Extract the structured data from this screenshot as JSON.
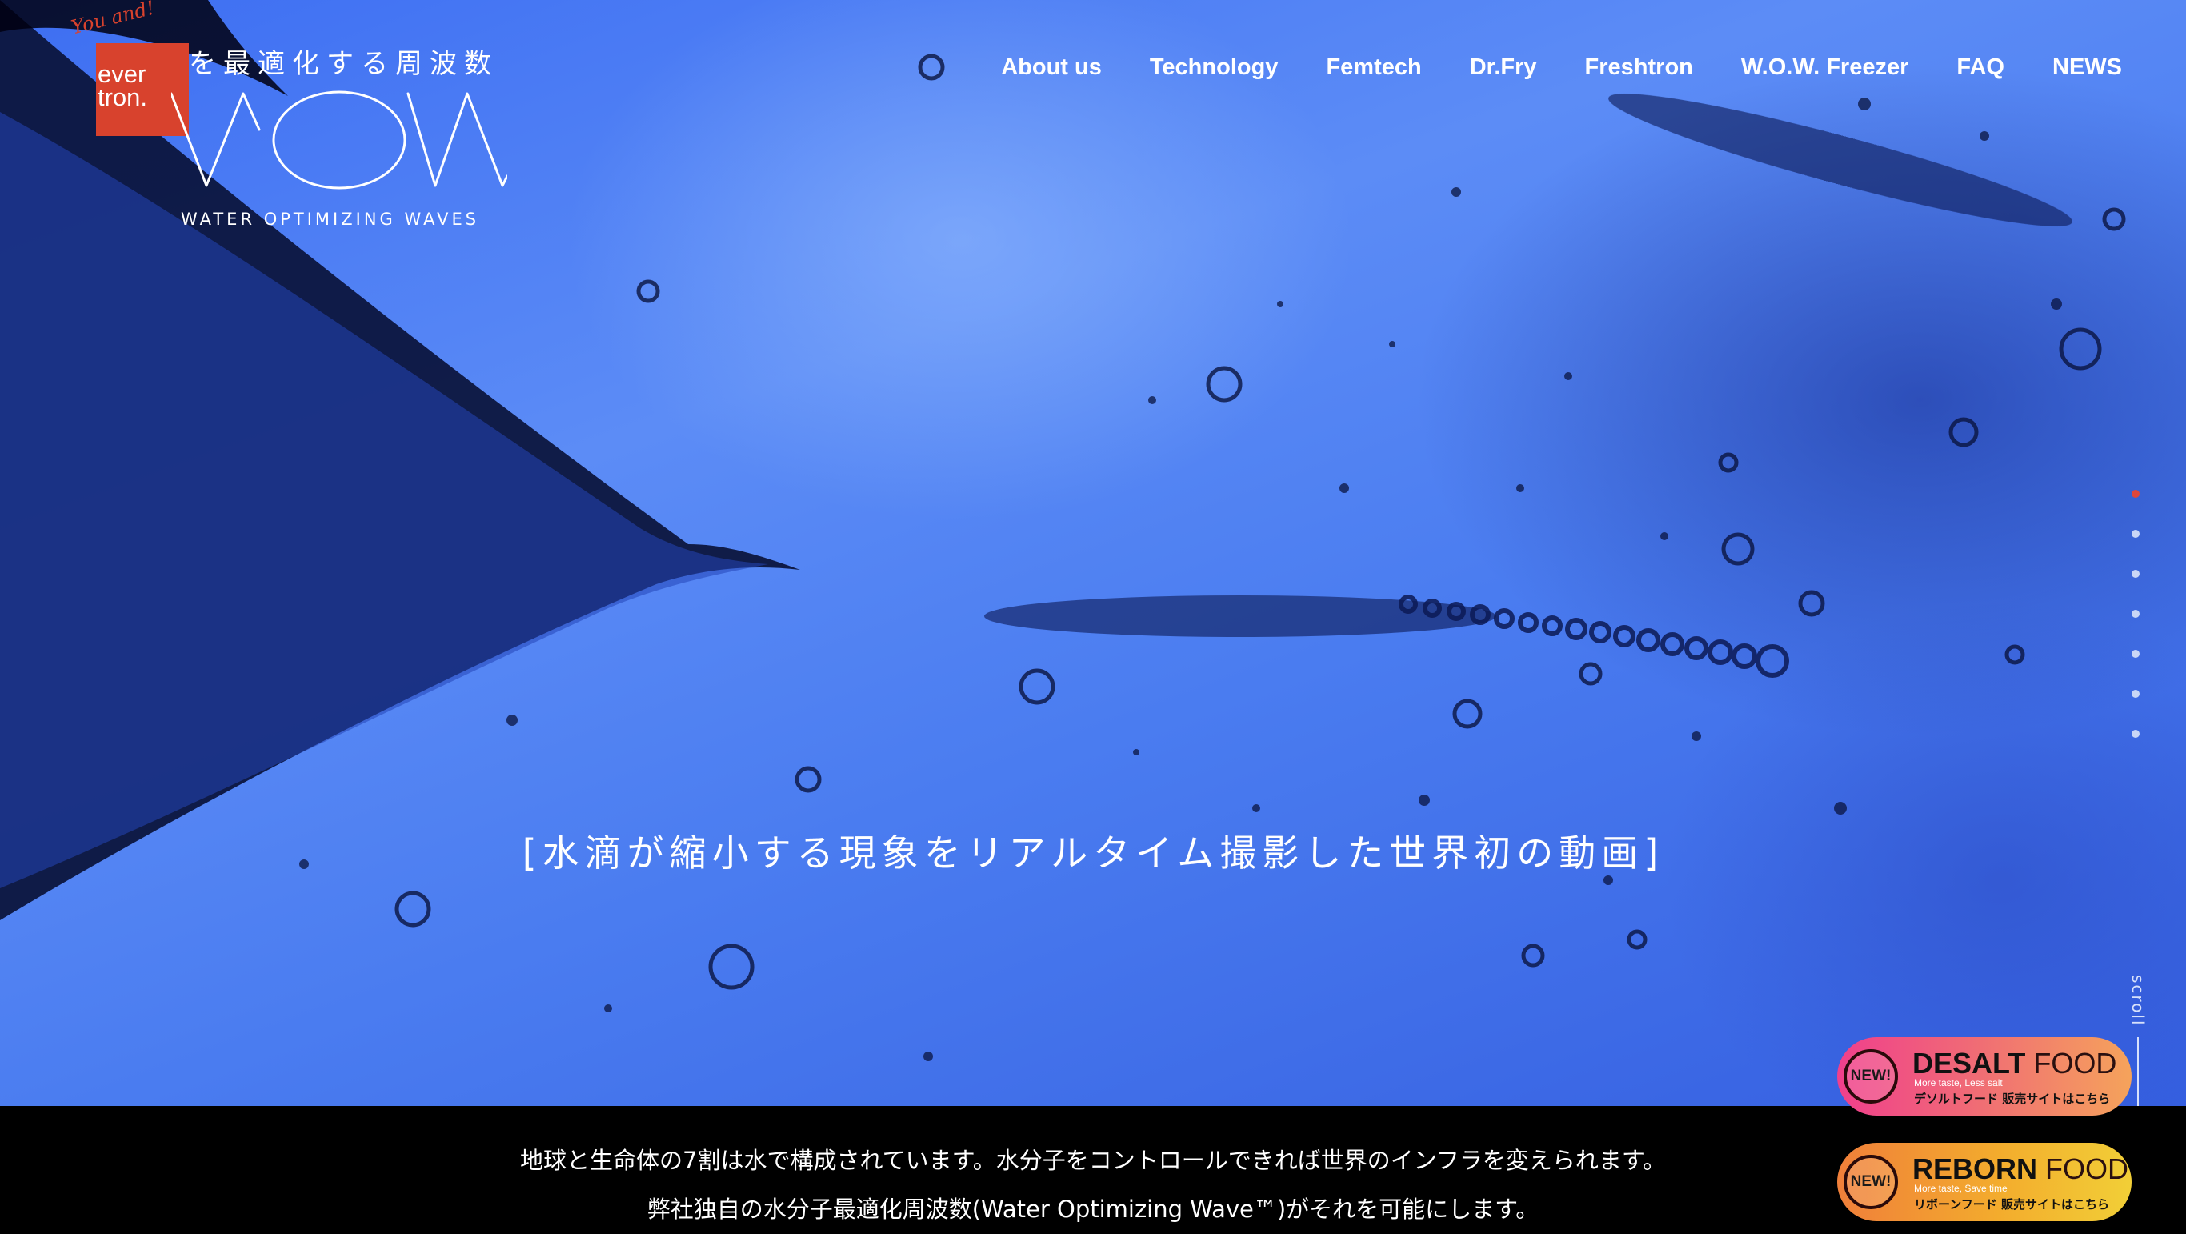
{
  "brand": {
    "logo_text": "ever\ntron.",
    "logo_youand": "You and!",
    "tagline": "を最適化する周波数",
    "wordmark": "WOW",
    "wordmark_sub": "WATER OPTIMIZING WAVES",
    "accent": "#d8422d"
  },
  "nav": {
    "items": [
      "About us",
      "Technology",
      "Femtech",
      "Dr.Fry",
      "Freshtron",
      "W.O.W. Freezer",
      "FAQ",
      "NEWS"
    ]
  },
  "hero": {
    "caption": "[水滴が縮小する現象をリアルタイム撮影した世界初の動画]",
    "scroll_label": "scroll",
    "slide_indicator": {
      "count": 7,
      "active": 1
    }
  },
  "blurb": {
    "line1": "地球と生命体の7割は水で構成されています。水分子をコントロールできれば世界のインフラを変えられます。",
    "line2": "弊社独自の水分子最適化周波数(Water Optimizing Wave™)がそれを可能にします。"
  },
  "promos": {
    "desalt": {
      "badge": "NEW!",
      "title_bold": "DESALT",
      "title_light": "FOOD",
      "sub": "More taste, Less salt",
      "jp": "デソルトフード 販売サイトはこちら"
    },
    "reborn": {
      "badge": "NEW!",
      "title_bold": "REBORN",
      "title_light": "FOOD",
      "sub": "More taste, Save time",
      "jp": "リボーンフード 販売サイトはこちら"
    }
  }
}
